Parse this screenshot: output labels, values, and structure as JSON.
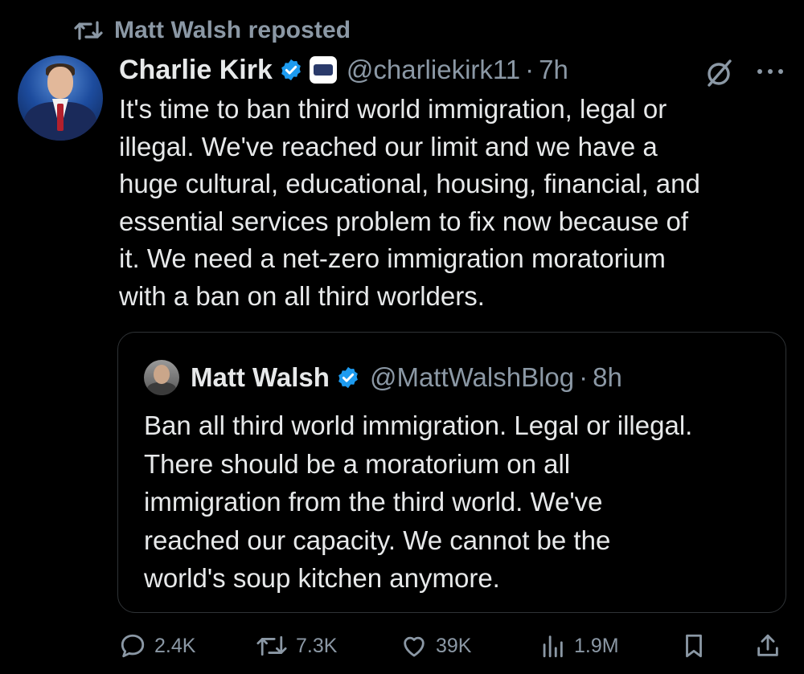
{
  "repost": {
    "label": "Matt Walsh reposted"
  },
  "tweet": {
    "author_name": "Charlie Kirk",
    "handle": "@charliekirk11",
    "separator": "·",
    "time": "7h",
    "text": "It's time to ban third world immigration, legal or\nillegal. We've reached our limit and we have a\nhuge cultural, educational, housing, financial, and\nessential services problem to fix now because of\nit. We need a net-zero immigration moratorium\nwith a ban on all third worlders."
  },
  "quote": {
    "author_name": "Matt Walsh",
    "handle": "@MattWalshBlog",
    "separator": "·",
    "time": "8h",
    "text": "Ban all third world immigration. Legal or illegal.\nThere should be a moratorium on all\nimmigration from the third world. We've\nreached our capacity. We cannot be the\nworld's soup kitchen anymore."
  },
  "actions": {
    "replies": "2.4K",
    "reposts": "7.3K",
    "likes": "39K",
    "views": "1.9M"
  },
  "icons": {
    "repost": "repost-icon",
    "verified": "verified-badge-icon",
    "affiliate": "affiliate-badge-icon",
    "grok": "grok-icon",
    "more": "more-options-icon",
    "reply": "reply-icon",
    "like": "like-icon",
    "views": "views-icon",
    "bookmark": "bookmark-icon",
    "share": "share-icon"
  },
  "colors": {
    "background": "#000000",
    "text": "#e7e9ea",
    "secondary": "#8b98a5",
    "verified": "#1d9bf0",
    "border": "#2f3336"
  }
}
